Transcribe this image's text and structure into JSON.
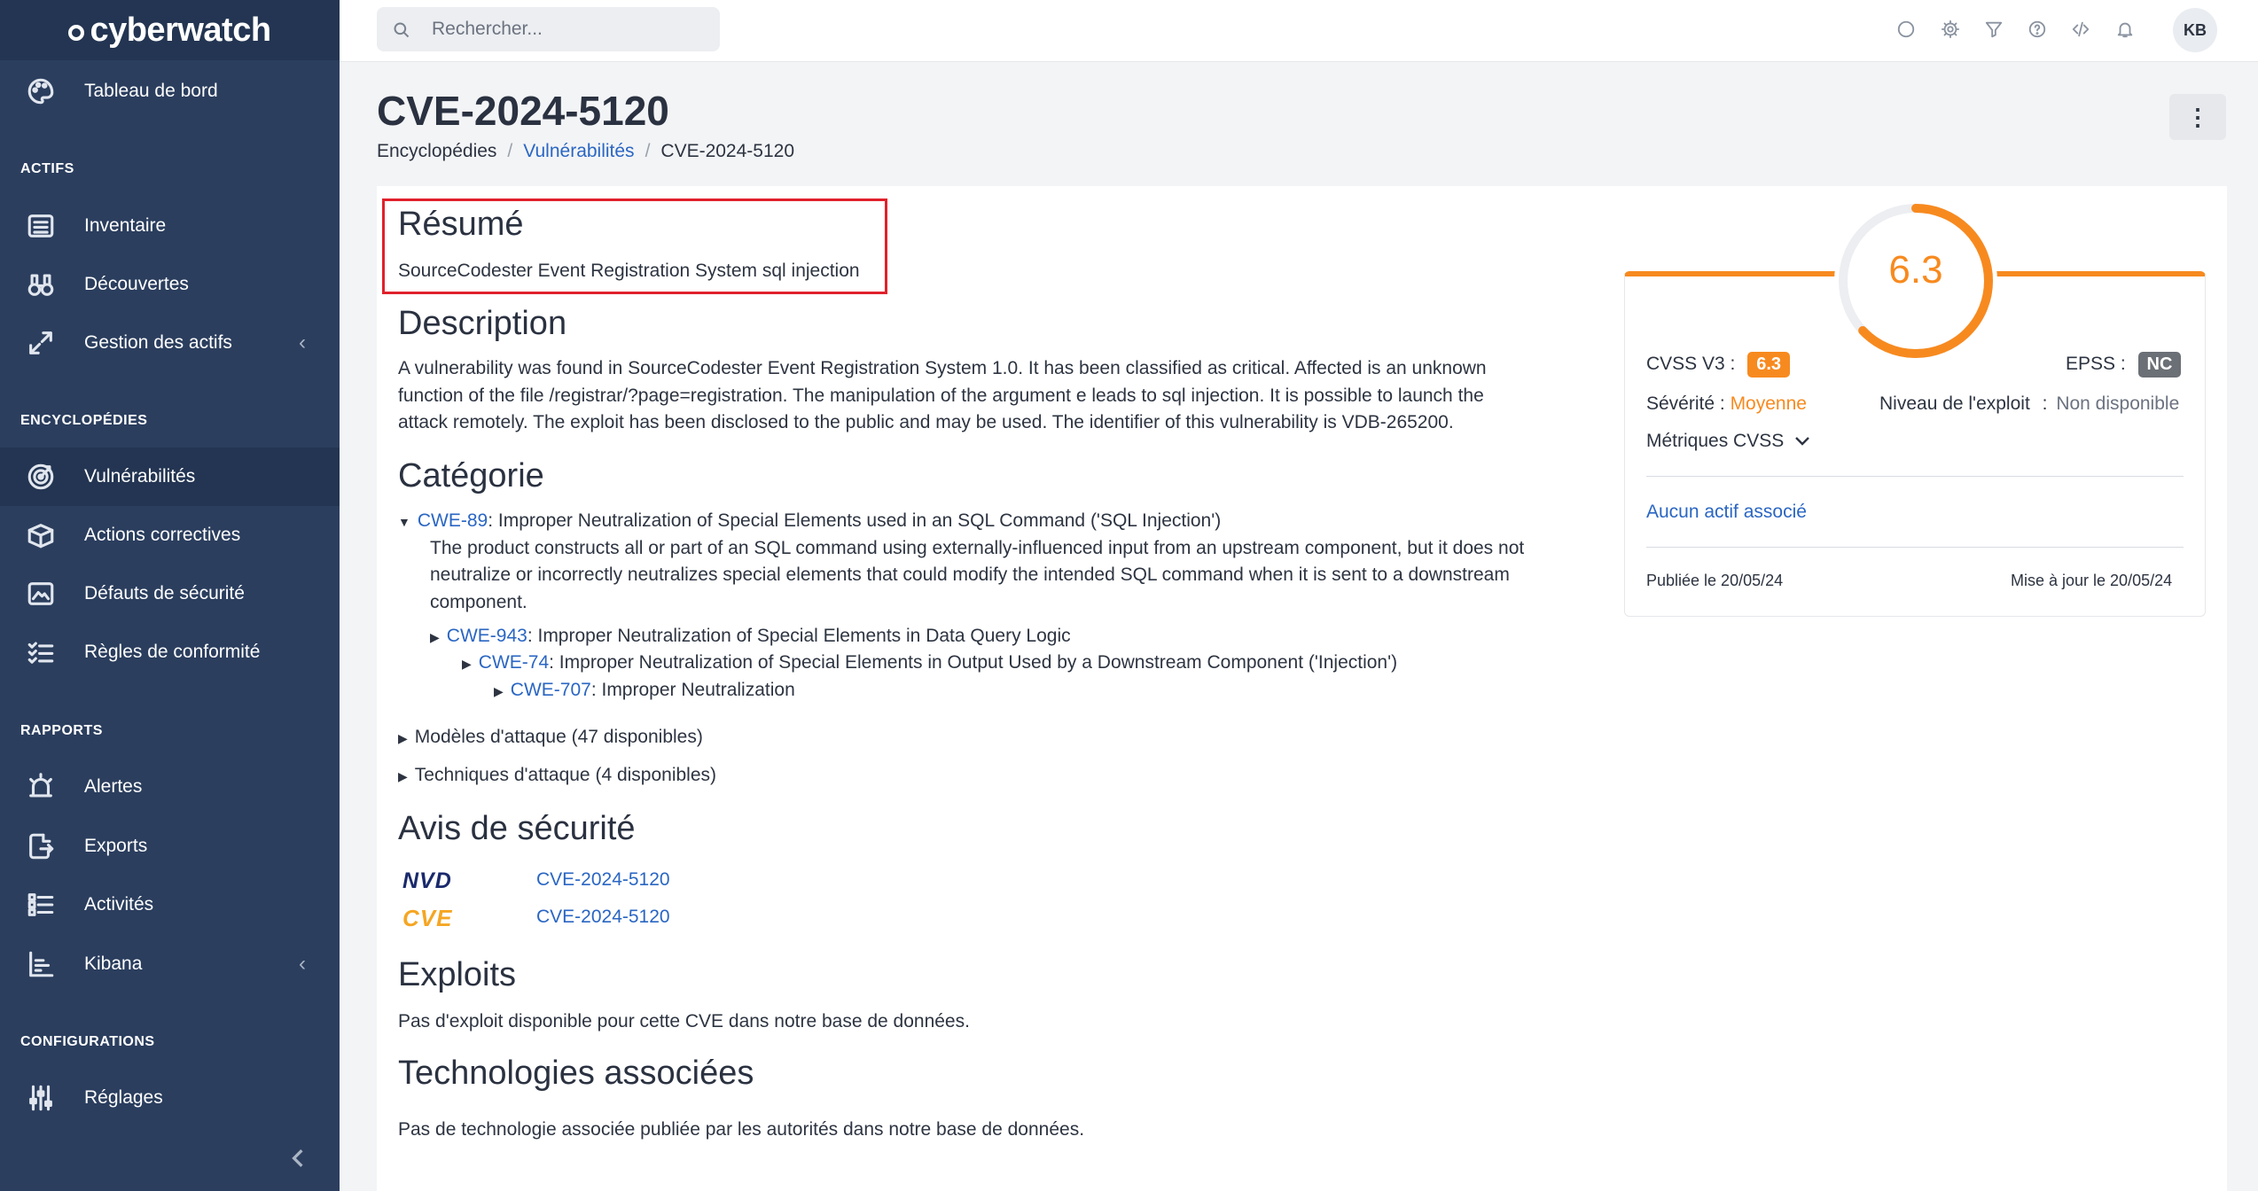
{
  "app": {
    "name": "cyberwatch"
  },
  "sidebar": {
    "items": [
      {
        "label": "Tableau de bord"
      },
      {
        "label": "Inventaire"
      },
      {
        "label": "Découvertes"
      },
      {
        "label": "Gestion des actifs"
      },
      {
        "label": "Vulnérabilités"
      },
      {
        "label": "Actions correctives"
      },
      {
        "label": "Défauts de sécurité"
      },
      {
        "label": "Règles de conformité"
      },
      {
        "label": "Alertes"
      },
      {
        "label": "Exports"
      },
      {
        "label": "Activités"
      },
      {
        "label": "Kibana"
      },
      {
        "label": "Réglages"
      }
    ],
    "sections": {
      "actifs": "ACTIFS",
      "encyclopedies": "ENCYCLOPÉDIES",
      "rapports": "RAPPORTS",
      "configurations": "CONFIGURATIONS"
    }
  },
  "topbar": {
    "search_placeholder": "Rechercher...",
    "avatar": "KB"
  },
  "page": {
    "title": "CVE-2024-5120",
    "breadcrumb": [
      "Encyclopédies",
      "Vulnérabilités",
      "CVE-2024-5120"
    ]
  },
  "resume": {
    "heading": "Résumé",
    "text": "SourceCodester Event Registration System sql injection"
  },
  "description": {
    "heading": "Description",
    "lines": [
      "A vulnerability was found in SourceCodester Event Registration System 1.0. It has been classified as critical. Affected is an unknown",
      "function of the file /registrar/?page=registration. The manipulation of the argument e leads to sql injection. It is possible to launch the",
      "attack remotely. The exploit has been disclosed to the public and may be used. The identifier of this vulnerability is VDB-265200."
    ]
  },
  "categorie": {
    "heading": "Catégorie",
    "cwe89": {
      "id": "CWE-89",
      "name": ": Improper Neutralization of Special Elements used in an SQL Command ('SQL Injection')"
    },
    "cwe89_desc": [
      "The product constructs all or part of an SQL command using externally-influenced input from an upstream component, but it does not",
      "neutralize or incorrectly neutralizes special elements that could modify the intended SQL command when it is sent to a downstream",
      "component."
    ],
    "cwe943": {
      "id": "CWE-943",
      "name": ": Improper Neutralization of Special Elements in Data Query Logic"
    },
    "cwe74": {
      "id": "CWE-74",
      "name": ": Improper Neutralization of Special Elements in Output Used by a Downstream Component ('Injection')"
    },
    "cwe707": {
      "id": "CWE-707",
      "name": ": Improper Neutralization"
    },
    "modeles": "Modèles d'attaque (47 disponibles)",
    "techniques": "Techniques d'attaque (4 disponibles)"
  },
  "avis": {
    "heading": "Avis de sécurité",
    "items": [
      {
        "logo": "NVD",
        "link": "CVE-2024-5120"
      },
      {
        "logo": "CVE",
        "link": "CVE-2024-5120"
      }
    ]
  },
  "exploits": {
    "heading": "Exploits",
    "text": "Pas d'exploit disponible pour cette CVE dans notre base de données."
  },
  "technologies": {
    "heading": "Technologies associées",
    "text": "Pas de technologie associée publiée par les autorités dans notre base de données."
  },
  "score_panel": {
    "score": "6.3",
    "score_fraction": 0.63,
    "cvss_label": "CVSS V3 :",
    "cvss_value": "6.3",
    "epss_label": "EPSS :",
    "epss_value": "NC",
    "severite_label": "Sévérité :",
    "severite_value": "Moyenne",
    "exploit_label": "Niveau de l'exploit",
    "exploit_sep": ":",
    "exploit_value": "Non disponible",
    "metrics_label": "Métriques CVSS",
    "assets_link": "Aucun actif associé",
    "published": "Publiée le 20/05/24",
    "updated": "Mise à jour le 20/05/24"
  },
  "colors": {
    "accent_orange": "#f78a1f",
    "sidebar": "#2b3e5e",
    "link": "#2a66c3",
    "highlight_box": "#e0212b"
  }
}
